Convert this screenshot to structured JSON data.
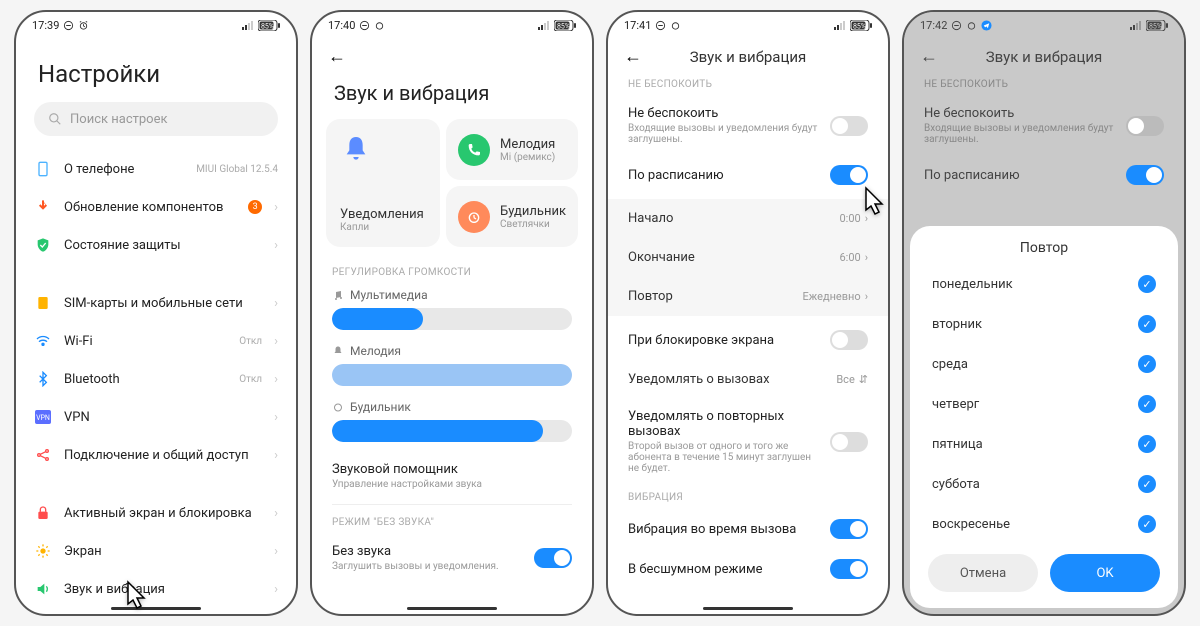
{
  "screens": {
    "s1": {
      "time": "17:39",
      "battery": "85%",
      "title": "Настройки",
      "search_placeholder": "Поиск настроек",
      "rows": {
        "about": {
          "label": "О телефоне",
          "meta": "MIUI Global 12.5.4"
        },
        "update": {
          "label": "Обновление компонентов",
          "badge": "3"
        },
        "security": {
          "label": "Состояние защиты"
        },
        "sim": {
          "label": "SIM-карты и мобильные сети"
        },
        "wifi": {
          "label": "Wi-Fi",
          "meta": "Откл"
        },
        "bt": {
          "label": "Bluetooth",
          "meta": "Откл"
        },
        "vpn": {
          "label": "VPN"
        },
        "share": {
          "label": "Подключение и общий доступ"
        },
        "lock": {
          "label": "Активный экран и блокировка"
        },
        "display": {
          "label": "Экран"
        },
        "sound": {
          "label": "Звук и вибрация"
        }
      }
    },
    "s2": {
      "time": "17:40",
      "battery": "85%",
      "title": "Звук и вибрация",
      "cards": {
        "notif": {
          "label": "Уведомления",
          "sub": "Капли"
        },
        "ring": {
          "label": "Мелодия",
          "sub": "Mi (ремикс)"
        },
        "alarm": {
          "label": "Будильник",
          "sub": "Светлячки"
        }
      },
      "vol_section": "РЕГУЛИРОВКА ГРОМКОСТИ",
      "vol": {
        "media": "Мультимедиа",
        "ring": "Мелодия",
        "alarm": "Будильник"
      },
      "helper": {
        "label": "Звуковой помощник",
        "sub": "Управление настройками звука"
      },
      "silent_section": "РЕЖИМ \"БЕЗ ЗВУКА\"",
      "silent": {
        "label": "Без звука",
        "sub": "Заглушить вызовы и уведомления."
      }
    },
    "s3": {
      "time": "17:41",
      "battery": "85%",
      "title": "Звук и вибрация",
      "dnd_section": "НЕ БЕСПОКОИТЬ",
      "dnd": {
        "label": "Не беспокоить",
        "sub": "Входящие вызовы и уведомления будут заглушены."
      },
      "schedule_label": "По расписанию",
      "start": {
        "label": "Начало",
        "val": "0:00"
      },
      "end": {
        "label": "Окончание",
        "val": "6:00"
      },
      "repeat": {
        "label": "Повтор",
        "val": "Ежедневно"
      },
      "locked": "При блокировке экрана",
      "calls": {
        "label": "Уведомлять о вызовах",
        "val": "Все"
      },
      "repeated": {
        "label": "Уведомлять о повторных вызовах",
        "sub": "Второй вызов от одного и того же абонента в течение 15 минут заглушен не будет."
      },
      "vib_section": "ВИБРАЦИЯ",
      "vib_call": "Вибрация во время вызова",
      "vib_silent": "В бесшумном режиме"
    },
    "s4": {
      "time": "17:42",
      "battery": "85%",
      "title": "Звук и вибрация",
      "dnd_section": "НЕ БЕСПОКОИТЬ",
      "dnd": {
        "label": "Не беспокоить",
        "sub": "Входящие вызовы и уведомления будут заглушены."
      },
      "schedule_label": "По расписанию",
      "sheet_title": "Повтор",
      "days": {
        "mon": "понедельник",
        "tue": "вторник",
        "wed": "среда",
        "thu": "четверг",
        "fri": "пятница",
        "sat": "суббота",
        "sun": "воскресенье"
      },
      "cancel": "Отмена",
      "ok": "OK"
    }
  }
}
